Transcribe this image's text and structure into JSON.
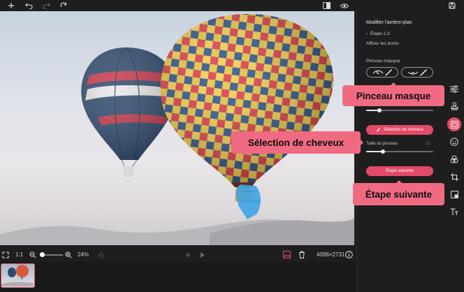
{
  "panel": {
    "title": "Modifier l'arrière-plan",
    "step": "Étape 2.3",
    "subtitle": "Affiner les bords",
    "brush_label": "Pinceau masque",
    "hair_button": "Sélection de cheveux",
    "brush_size_label": "Taille du pinceau",
    "brush_size_value": "21",
    "next_button": "Étape suivante",
    "brush_size_level": 0.25,
    "upper_slider_level": 0.2
  },
  "callouts": {
    "brush_mask": "Pinceau masque",
    "hair_selection": "Sélection de cheveux",
    "next_step": "Étape suivante"
  },
  "bottombar": {
    "ratio_label": "1:1",
    "zoom_level": "24%",
    "dimensions": "4096×2731",
    "zoom_fraction": 0.24
  },
  "colors": {
    "accent": "#e24a66",
    "callout": "#f06b82",
    "background": "#1e1e1f"
  },
  "icons": {
    "top_left": [
      "plus-icon",
      "undo-icon",
      "redo-icon",
      "reset-icon"
    ],
    "top_right": [
      "compare-icon",
      "eye-icon",
      "save-icon"
    ],
    "rail": [
      "adjust-icon",
      "stamp-icon",
      "background-icon",
      "face-icon",
      "effects-icon",
      "crop-icon",
      "frame-icon",
      "text-icon"
    ]
  }
}
